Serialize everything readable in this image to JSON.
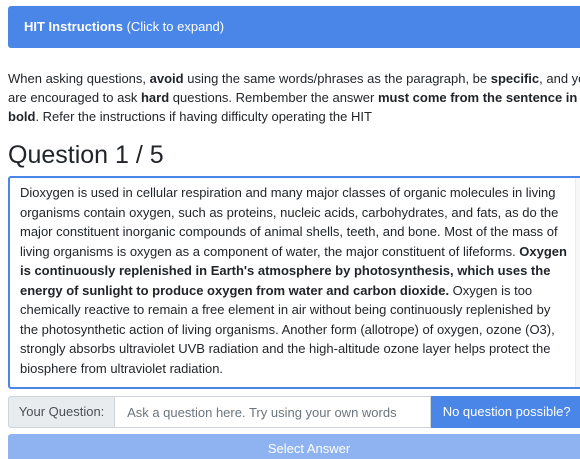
{
  "hit_banner": {
    "title": "HIT Instructions",
    "hint": "(Click to expand)"
  },
  "instructions": {
    "t1": "When asking questions, ",
    "b1": "avoid",
    "t2": " using the same words/phrases as the paragraph, be ",
    "b2": "specific",
    "t3": ", and you are encouraged to ask ",
    "b3": "hard",
    "t4": " questions. Rembember the answer ",
    "b4": "must come from the sentence in bold",
    "t5": ". Refer the instructions if having difficulty operating the HIT"
  },
  "question": {
    "heading": "Question 1 / 5"
  },
  "passage": {
    "before_bold": "Dioxygen is used in cellular respiration and many major classes of organic molecules in living organisms contain oxygen, such as proteins, nucleic acids, carbohydrates, and fats, as do the major constituent inorganic compounds of animal shells, teeth, and bone. Most of the mass of living organisms is oxygen as a component of water, the major constituent of lifeforms. ",
    "bold": "Oxygen is continuously replenished in Earth's atmosphere by photosynthesis, which uses the energy of sunlight to produce oxygen from water and carbon dioxide.",
    "after_bold": " Oxygen is too chemically reactive to remain a free element in air without being continuously replenished by the photosynthetic action of living organisms. Another form (allotrope) of oxygen, ozone (O3), strongly absorbs ultraviolet UVB radiation and the high-altitude ozone layer helps protect the biosphere from ultraviolet radiation."
  },
  "question_input": {
    "label": "Your Question:",
    "value": "",
    "placeholder": "Ask a question here. Try using your own words",
    "no_question_label": "No question possible?"
  },
  "select_answer": {
    "label": "Select Answer"
  },
  "colors": {
    "primary": "#4a86e8",
    "primary_disabled": "#8fb3f0",
    "text": "#212529"
  }
}
